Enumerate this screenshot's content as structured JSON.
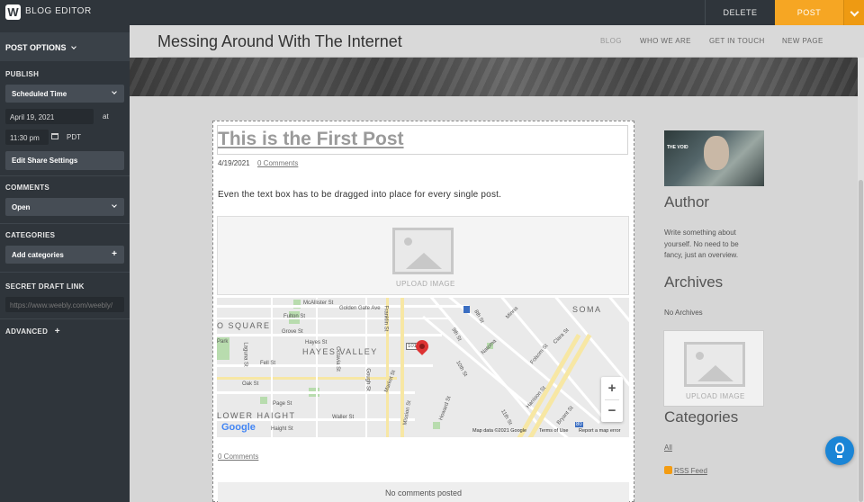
{
  "topbar": {
    "logo": "W",
    "app_title": "BLOG EDITOR",
    "delete_label": "DELETE",
    "post_label": "POST"
  },
  "sidebar": {
    "post_options_label": "POST OPTIONS",
    "publish_label": "PUBLISH",
    "schedule_select": "Scheduled Time",
    "date_value": "April 19, 2021",
    "at_label": "at",
    "time_value": "11:30 pm",
    "timezone": "PDT",
    "share_settings_label": "Edit Share Settings",
    "comments_label": "COMMENTS",
    "comments_select": "Open",
    "categories_label": "CATEGORIES",
    "add_categories_label": "Add categories",
    "secret_link_label": "SECRET DRAFT LINK",
    "secret_link_value": "https://www.weebly.com/weebly/",
    "advanced_label": "ADVANCED"
  },
  "site": {
    "title": "Messing Around With The Internet",
    "nav": [
      "BLOG",
      "WHO WE ARE",
      "GET IN TOUCH",
      "NEW PAGE"
    ]
  },
  "post": {
    "title": "This is the First Post",
    "date": "4/19/2021",
    "comments_link": "0 Comments",
    "body": "Even the text box has to be dragged into place for every single post.",
    "upload_label": "UPLOAD IMAGE",
    "bottom_comments_link": "0 Comments",
    "no_comments": "No comments posted"
  },
  "map": {
    "areas": [
      "O SQUARE",
      "HAYES VALLEY",
      "LOWER HAIGHT",
      "SOMA"
    ],
    "streets": [
      "Fell St",
      "Oak St",
      "Hayes St",
      "Grove St",
      "Fulton St",
      "McAllister St",
      "Golden Gate Ave",
      "Franklin St",
      "Gough St",
      "Market St",
      "Mission St",
      "Howard St",
      "Folsom St",
      "Harrison St",
      "Bryant St",
      "8th St",
      "9th St",
      "10th St",
      "11th St",
      "Page St",
      "Haight St",
      "Waller St",
      "Minna",
      "Natoma",
      "Clara St",
      "Laguna St",
      "Octavia St"
    ],
    "highway": "101",
    "interstate": "80",
    "park_label": "Park",
    "google_logo": "Google",
    "attribution": "Map data ©2021 Google",
    "terms": "Terms of Use",
    "report": "Report a map error",
    "zoom_in": "+",
    "zoom_out": "−"
  },
  "right": {
    "author_image_caption": "THE VOID",
    "author_heading": "Author",
    "author_text": "Write something about yourself. No need to be fancy, just an overview.",
    "archives_heading": "Archives",
    "archives_text": "No Archives",
    "upload_label": "UPLOAD IMAGE",
    "categories_heading": "Categories",
    "all_link": "All",
    "rss_link": "RSS Feed"
  },
  "colors": {
    "post_button": "#f6a623",
    "dark_panel": "#2f353b",
    "help_button": "#1a85d6"
  }
}
